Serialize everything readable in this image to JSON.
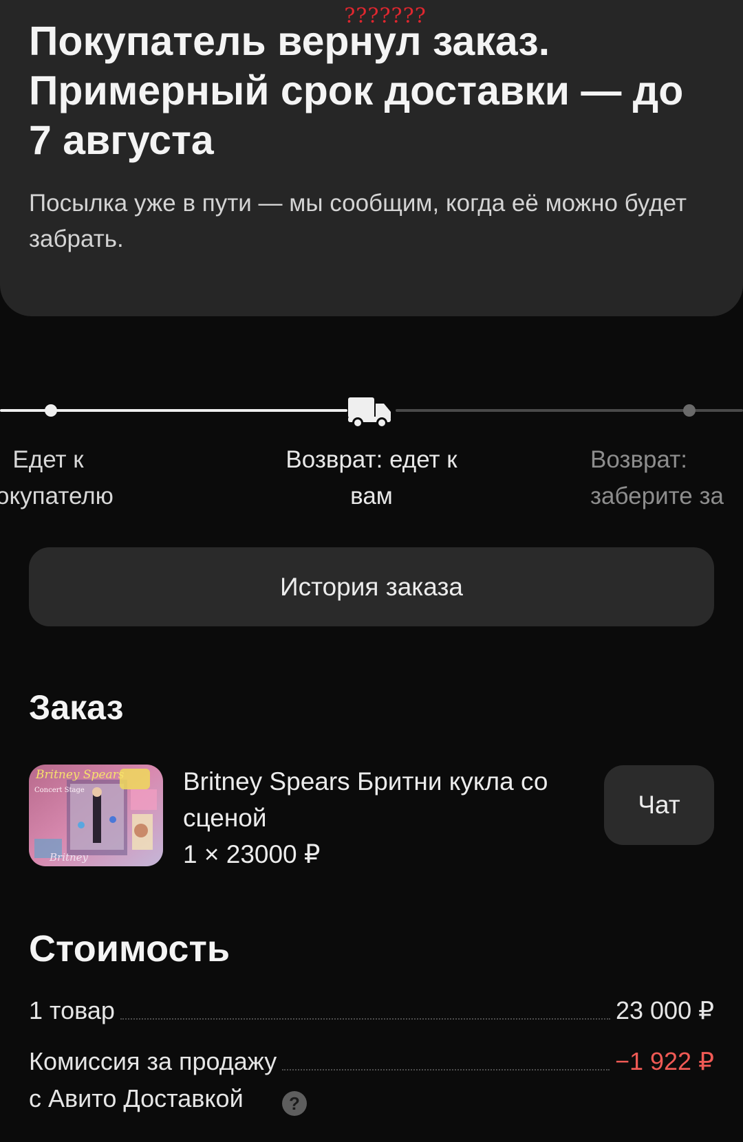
{
  "status": {
    "note": "???????",
    "headline": "Покупатель вернул заказ. Примерный срок доставки — до 7 августа",
    "subtitle": "Посылка уже в пути — мы сообщим, когда её можно будет забрать."
  },
  "tracker": {
    "current_step": 2,
    "steps": [
      {
        "label": "Едет к\nпокупателю",
        "state": "done"
      },
      {
        "label": "Возврат: едет к\nвам",
        "state": "current"
      },
      {
        "label": "Возврат:\nзаберите за",
        "state": "todo"
      }
    ],
    "icon": "truck-icon"
  },
  "history_button": {
    "label": "История заказа"
  },
  "order": {
    "title": "Заказ",
    "item": {
      "name": "Britney Spears Бритни кукла со сценой",
      "quantity_price": "1 × 23000 ₽",
      "image_text_top": "Britney Spears",
      "image_text_stage": "Concert Stage",
      "image_text_bottom": "Britney"
    },
    "chat_button": {
      "label": "Чат"
    }
  },
  "cost": {
    "title": "Стоимость",
    "rows": [
      {
        "label": "1 товар",
        "value": "23 000 ₽"
      },
      {
        "label": "Комиссия за продажу\nс Авито Доставкой",
        "value": "−1 922 ₽",
        "help_icon": "question-icon"
      }
    ]
  },
  "colors": {
    "background": "#0b0b0b",
    "card": "#262626",
    "negative": "#f05a55",
    "note": "#e0272f"
  }
}
